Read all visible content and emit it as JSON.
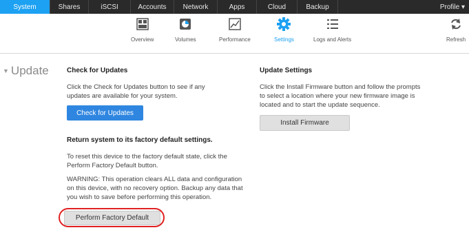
{
  "topnav": {
    "tabs": [
      {
        "label": "System",
        "active": true
      },
      {
        "label": "Shares",
        "active": false
      },
      {
        "label": "iSCSI",
        "active": false
      },
      {
        "label": "Accounts",
        "active": false
      },
      {
        "label": "Network",
        "active": false
      },
      {
        "label": "Apps",
        "active": false
      },
      {
        "label": "Cloud",
        "active": false
      },
      {
        "label": "Backup",
        "active": false
      }
    ],
    "profile_label": "Profile ▾"
  },
  "toolbar": {
    "items": [
      {
        "label": "Overview",
        "icon": "overview-icon"
      },
      {
        "label": "Volumes",
        "icon": "volumes-icon"
      },
      {
        "label": "Performance",
        "icon": "performance-icon"
      },
      {
        "label": "Settings",
        "icon": "settings-gear-icon",
        "active": true
      },
      {
        "label": "Logs and Alerts",
        "icon": "logs-icon"
      }
    ],
    "refresh_label": "Refresh"
  },
  "section_title": "Update",
  "check_updates": {
    "heading": "Check for Updates",
    "text_line1": "Click the Check for Updates button to see if any",
    "text_line2": "updates are available for your system.",
    "button_label": "Check for Updates"
  },
  "update_settings": {
    "heading": "Update Settings",
    "text_line1": "Click the Install Firmware button and follow the prompts",
    "text_line2": "to select a location where your new firmware image is",
    "text_line3": "located and to start the update sequence.",
    "button_label": "Install Firmware"
  },
  "factory_reset": {
    "heading": "Return system to its factory default settings.",
    "text_line1": "To reset this device to the factory default state, click the",
    "text_line2": "Perform Factory Default button.",
    "warning_line1": "WARNING: This operation clears ALL data and configuration",
    "warning_line2": "on this device, with no recovery option. Backup any data that",
    "warning_line3": "you wish to save before performing this operation.",
    "button_label": "Perform Factory Default"
  },
  "colors": {
    "nav_bg": "#2a2a2a",
    "accent": "#1da1f2",
    "primary_button": "#2f86e0",
    "highlight_oval": "#e02020"
  }
}
